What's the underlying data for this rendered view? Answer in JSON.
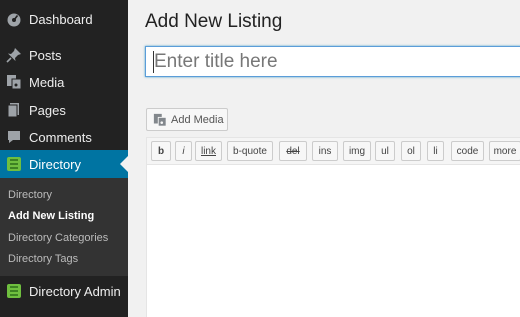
{
  "sidebar": {
    "items": [
      {
        "label": "Dashboard",
        "icon": "dashboard-icon"
      },
      {
        "label": "Posts",
        "icon": "pin-icon"
      },
      {
        "label": "Media",
        "icon": "media-icon"
      },
      {
        "label": "Pages",
        "icon": "pages-icon"
      },
      {
        "label": "Comments",
        "icon": "comment-icon"
      },
      {
        "label": "Directory",
        "icon": "directory-icon",
        "active": true
      }
    ],
    "submenu": [
      {
        "label": "Directory"
      },
      {
        "label": "Add New Listing",
        "current": true
      },
      {
        "label": "Directory Categories"
      },
      {
        "label": "Directory Tags"
      }
    ],
    "bottom_item": {
      "label": "Directory Admin",
      "icon": "directory-admin-icon"
    },
    "colors": {
      "background": "#222222",
      "active": "#0074a2",
      "submenu": "#333333"
    }
  },
  "main": {
    "page_title": "Add New Listing",
    "title_placeholder": "Enter title here",
    "add_media_label": "Add Media",
    "toolbar_buttons": [
      "b",
      "i",
      "link",
      "b-quote",
      "del",
      "ins",
      "img",
      "ul",
      "ol",
      "li",
      "code",
      "more"
    ]
  }
}
